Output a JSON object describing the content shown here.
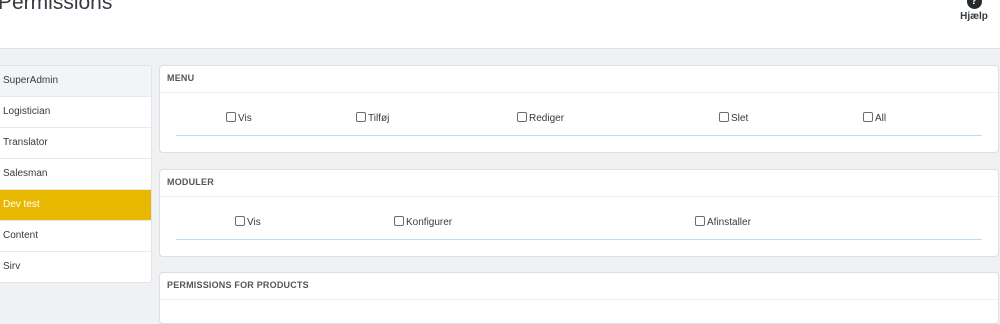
{
  "header": {
    "title": "Permissions",
    "help_label": "Hjælp"
  },
  "sidebar": {
    "items": [
      {
        "label": "SuperAdmin"
      },
      {
        "label": "Logistician"
      },
      {
        "label": "Translator"
      },
      {
        "label": "Salesman"
      },
      {
        "label": "Dev test"
      },
      {
        "label": "Content"
      },
      {
        "label": "Sirv"
      }
    ],
    "active": "Dev test"
  },
  "panels": {
    "menu": {
      "heading": "MENU",
      "options": [
        {
          "label": "Vis",
          "checked": false
        },
        {
          "label": "Tilføj",
          "checked": false
        },
        {
          "label": "Rediger",
          "checked": false
        },
        {
          "label": "Slet",
          "checked": false
        },
        {
          "label": "All",
          "checked": false
        }
      ]
    },
    "moduler": {
      "heading": "MODULER",
      "options": [
        {
          "label": "Vis",
          "checked": false
        },
        {
          "label": "Konfigurer",
          "checked": false
        },
        {
          "label": "Afinstaller",
          "checked": false
        }
      ]
    },
    "products": {
      "heading": "PERMISSIONS FOR PRODUCTS"
    }
  },
  "colors": {
    "active_role": "#e8b800",
    "row_divider": "#bcdcf0",
    "background": "#eff1f2"
  }
}
